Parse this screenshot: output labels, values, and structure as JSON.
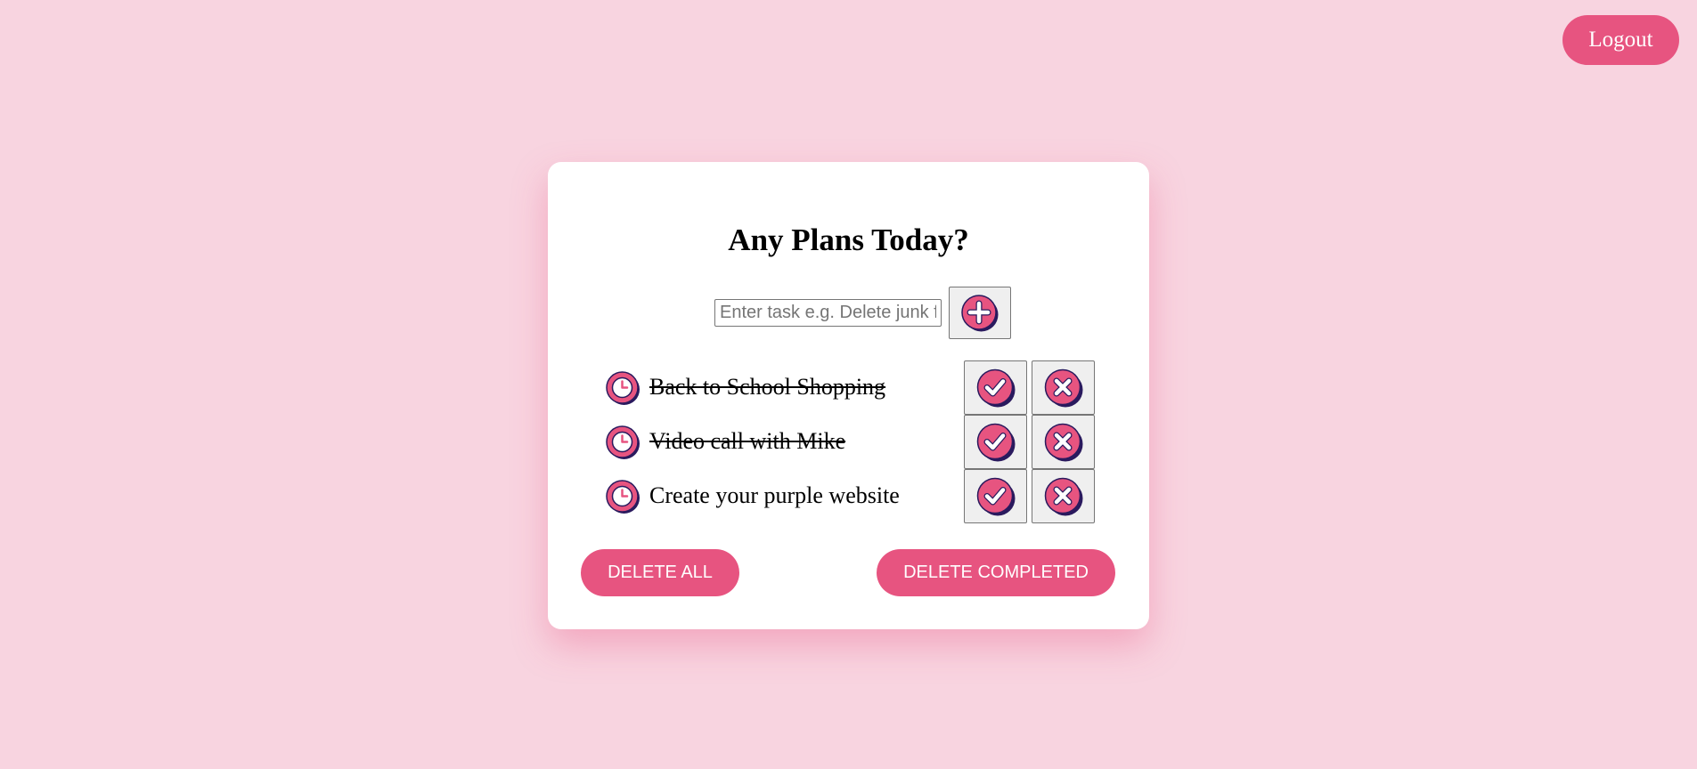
{
  "header": {
    "logout_label": "Logout"
  },
  "card": {
    "title": "Any Plans Today?",
    "input": {
      "value": "",
      "placeholder": "Enter task e.g. Delete junk files"
    }
  },
  "tasks": [
    {
      "text": "Back to School Shopping",
      "completed": true
    },
    {
      "text": "Video call with Mike",
      "completed": true
    },
    {
      "text": "Create your purple website",
      "completed": false
    }
  ],
  "actions": {
    "delete_all_label": "DELETE ALL",
    "delete_completed_label": "DELETE COMPLETED"
  },
  "icons": {
    "add": "plus-circle-icon",
    "clock": "clock-icon",
    "complete": "check-circle-icon",
    "remove": "x-circle-icon"
  },
  "colors": {
    "background": "#f8d4e0",
    "accent": "#e75480",
    "icon_shadow": "#2a1a5e",
    "card": "#ffffff"
  }
}
